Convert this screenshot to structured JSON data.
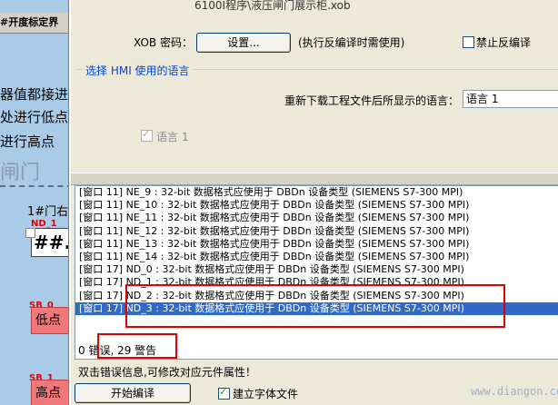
{
  "background": {
    "title": "#开度标定界",
    "lines": [
      "器值都接进",
      "处进行低点",
      "进行高点"
    ],
    "heading": "闸门",
    "label_1": "1#门右",
    "nd_label": "ND_1",
    "nd_value": "##.",
    "sb0_label": "SB_0",
    "sb0_text": "低点",
    "sb1_label": "SB_1",
    "sb1_text": "高点"
  },
  "dialog": {
    "path": "6100I程序\\液压闸门展示柜.xob",
    "xob_password_label": "XOB 密码：",
    "settings_button": "设置...",
    "settings_note": "(执行反编译时需使用)",
    "no_decompile_label": "禁止反编译",
    "no_decompile_checked": false,
    "hmi_group_title": "选择 HMI 使用的语言",
    "reload_label": "重新下载工程文件后所显示的语言：",
    "language_selected": "语言 1",
    "language1_label": "语言 1",
    "language1_checked": true,
    "log_rows": [
      "[窗口 11] NE_9 : 32-bit 数据格式应使用于 DBDn 设备类型 (SIEMENS S7-300 MPI)",
      "[窗口 11] NE_10 : 32-bit 数据格式应使用于 DBDn 设备类型 (SIEMENS S7-300 MPI)",
      "[窗口 11] NE_11 : 32-bit 数据格式应使用于 DBDn 设备类型 (SIEMENS S7-300 MPI)",
      "[窗口 11] NE_12 : 32-bit 数据格式应使用于 DBDn 设备类型 (SIEMENS S7-300 MPI)",
      "[窗口 11] NE_13 : 32-bit 数据格式应使用于 DBDn 设备类型 (SIEMENS S7-300 MPI)",
      "[窗口 11] NE_14 : 32-bit 数据格式应使用于 DBDn 设备类型 (SIEMENS S7-300 MPI)",
      "[窗口 17] ND_0 : 32-bit 数据格式应使用于 DBDn 设备类型 (SIEMENS S7-300 MPI)",
      "[窗口 17] ND_1 : 32-bit 数据格式应使用于 DBDn 设备类型 (SIEMENS S7-300 MPI)",
      "[窗口 17] ND_2 : 32-bit 数据格式应使用于 DBDn 设备类型 (SIEMENS S7-300 MPI)",
      "[窗口 17] ND_3 : 32-bit 数据格式应使用于 DBDn 设备类型 (SIEMENS S7-300 MPI)"
    ],
    "selected_row": 9,
    "log_summary": "0 错误, 29 警告",
    "hint": "双击错误信息,可修改对应元件属性！",
    "compile_button": "开始编译",
    "font_file_label": "建立字体文件",
    "font_file_checked": true,
    "watermark": "www.diangon.com"
  }
}
